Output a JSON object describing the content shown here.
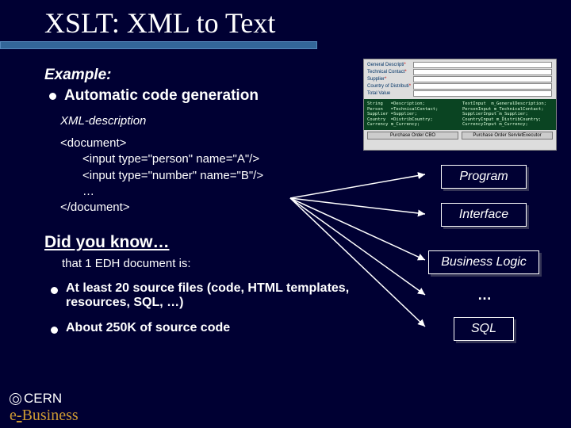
{
  "title": "XSLT: XML to Text",
  "example_label": "Example:",
  "bullet_main": "Automatic code generation",
  "xml_desc_label": "XML-description",
  "xml": {
    "l1": "<document>",
    "l2": "<input type=\"person\" name=\"A\"/>",
    "l3": "<input type=\"number\" name=\"B\"/>",
    "l4": "…",
    "l5": "</document>"
  },
  "did_you_know": "Did you know…",
  "sub_text": "that 1 EDH document is:",
  "bullet2a": "At least 20 source files (code, HTML templates, resources, SQL, …)",
  "bullet2b": "About 250K of source code",
  "labels": {
    "program": "Program",
    "interface": "Interface",
    "blogic": "Business Logic",
    "sql": "SQL",
    "dots": "…"
  },
  "footer": {
    "cern": "CERN",
    "ebiz_e": "e",
    "ebiz_dash": "-",
    "ebiz_rest": "Business"
  },
  "mock": {
    "f1": "General Descripti",
    "f2": "Technical Contact",
    "f3": "Supplier",
    "f4": "Country of Distributi",
    "f5": "Total Value",
    "code_left": "String   =Description;\nPerson   =TechnicalContact;\nSupplier =Supplier;\nCountry  =DistribCountry;\nCurrency m_Currency;",
    "code_right": "TextInput  m_GeneralDescription;\nPersonInput m_TechnicalContact;\nSupplierInput m_Supplier;\nCountryInput m_DistribCountry;\nCurrencyInput m_Currency;",
    "btn1": "Purchase Order CBO",
    "btn2": "Purchase Order ServletExecutor"
  }
}
